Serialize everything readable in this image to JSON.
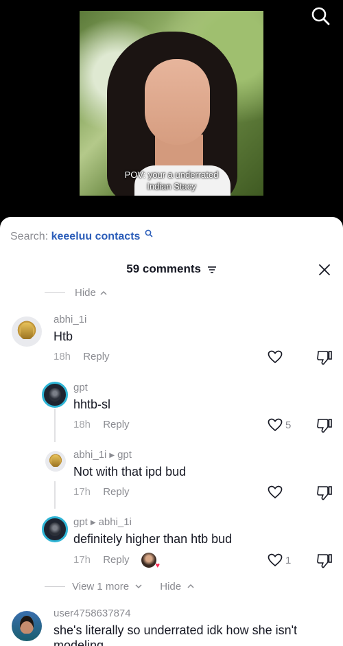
{
  "video": {
    "caption_line1": "POV: your a underrated",
    "caption_line2": "Indian Stacy"
  },
  "search": {
    "prefix": "Search:",
    "term": "keeeluu contacts"
  },
  "header": {
    "title": "59 comments"
  },
  "hide_top": "Hide",
  "comments": [
    {
      "user": "abhi_1i",
      "text": "Htb",
      "time": "18h",
      "reply": "Reply"
    },
    {
      "user": "gpt",
      "text": "hhtb-sl",
      "time": "18h",
      "reply": "Reply",
      "likes": "5"
    },
    {
      "user": "abhi_1i",
      "to": "gpt",
      "text": "Not with that ipd bud",
      "time": "17h",
      "reply": "Reply"
    },
    {
      "user": "gpt",
      "to": "abhi_1i",
      "text": "definitely higher than htb bud",
      "time": "17h",
      "reply": "Reply",
      "likes": "1"
    }
  ],
  "view_more": "View 1 more",
  "hide_bottom": "Hide",
  "last_comment": {
    "user": "user4758637874",
    "text": "she's literally so underrated idk how she isn't",
    "text2": "modeling"
  },
  "colors": {
    "link": "#2b5db9",
    "muted": "#8a8b91",
    "like_heart": "#fe2c55"
  }
}
